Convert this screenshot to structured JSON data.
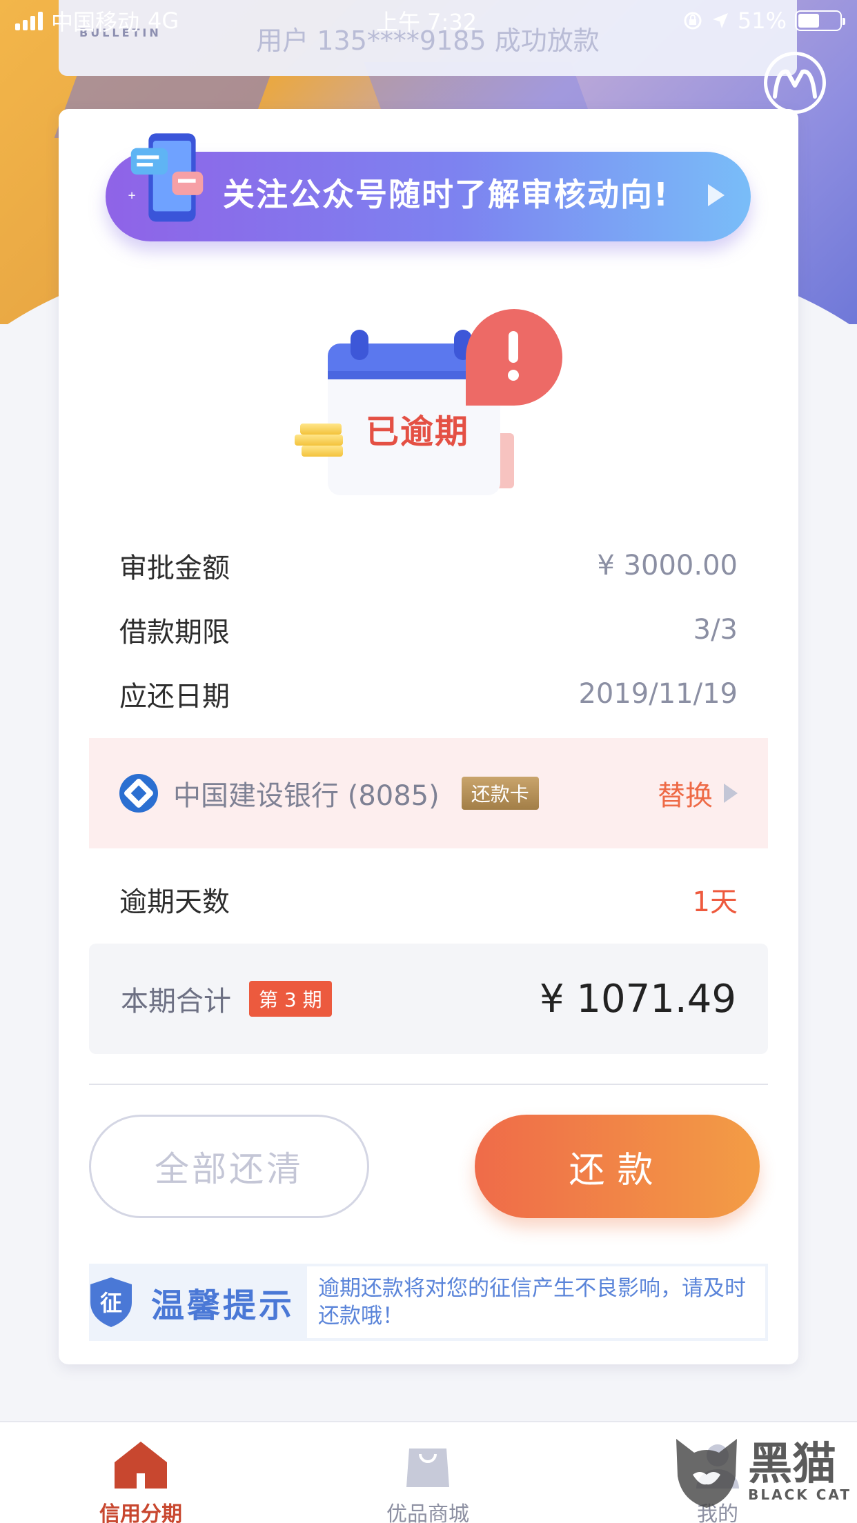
{
  "status_bar": {
    "carrier": "中国移动",
    "network": "4G",
    "time": "上午 7:32",
    "battery": "51%"
  },
  "bulletin": {
    "tag": "BULLETIN",
    "text": "用户 135****9185 成功放款"
  },
  "banner": {
    "text": "关注公众号随时了解审核动向!"
  },
  "status_illustration": {
    "label": "已逾期"
  },
  "loan_info": [
    {
      "label": "审批金额",
      "value": "¥ 3000.00"
    },
    {
      "label": "借款期限",
      "value": "3/3"
    },
    {
      "label": "应还日期",
      "value": "2019/11/19"
    }
  ],
  "bank": {
    "name": "中国建设银行 (8085)",
    "card_badge": "还款卡",
    "replace_label": "替换"
  },
  "overdue": {
    "label": "逾期天数",
    "value": "1天"
  },
  "total": {
    "label": "本期合计",
    "period_tag": "第 3 期",
    "amount": "¥ 1071.49"
  },
  "buttons": {
    "pay_all": "全部还清",
    "pay": "还款"
  },
  "tip": {
    "badge": "征",
    "title": "温馨提示",
    "body": "逾期还款将对您的征信产生不良影响，请及时还款哦！"
  },
  "tabbar": [
    {
      "label": "信用分期",
      "active": true
    },
    {
      "label": "优品商城",
      "active": false
    },
    {
      "label": "我的",
      "active": false
    }
  ],
  "watermark": {
    "cn": "黑猫",
    "en": "BLACK CAT"
  },
  "colors": {
    "accent": "#ef6b49",
    "overdue": "#ee5a3e",
    "tab_active": "#c8472f"
  }
}
